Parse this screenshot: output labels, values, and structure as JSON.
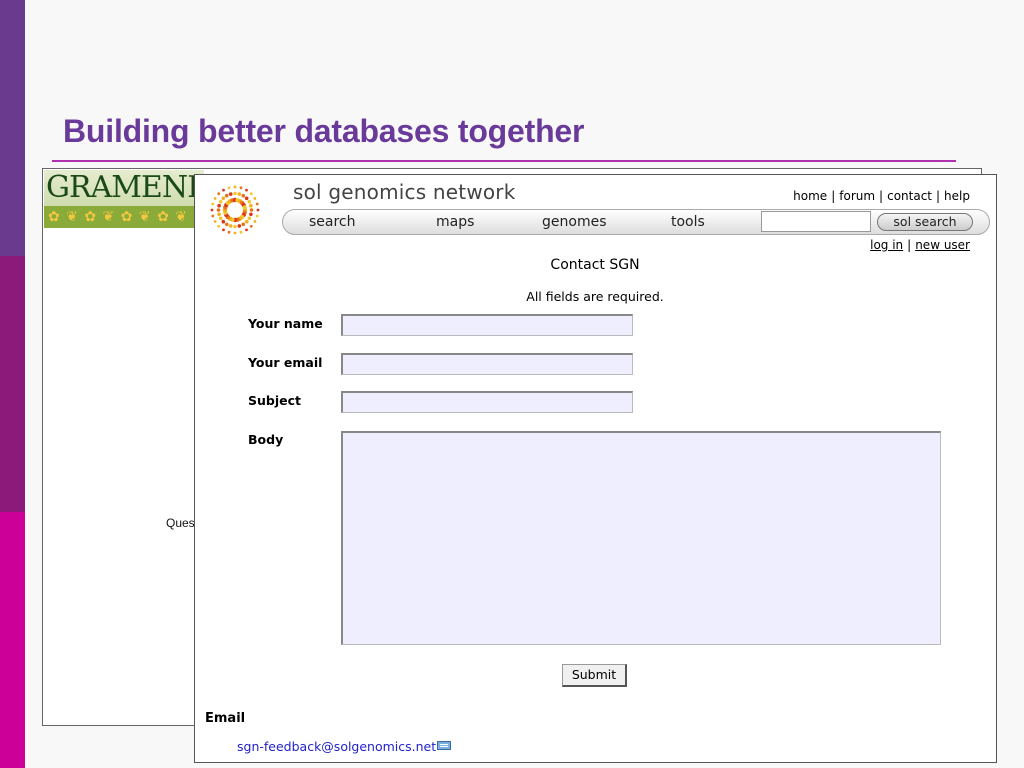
{
  "slide": {
    "title": "Building better databases together",
    "colors": {
      "bar_top": "#6a3a8e",
      "bar_mid": "#8b1a7a",
      "bar_bottom": "#cc0099",
      "title": "#6a3a9a"
    }
  },
  "gramene": {
    "logo_text": "GRAMENE",
    "partial_text": "Ques"
  },
  "sgn": {
    "site_name": "sol genomics network",
    "top_links": [
      "home",
      "forum",
      "contact",
      "help"
    ],
    "nav_items": [
      "search",
      "maps",
      "genomes",
      "tools"
    ],
    "search_placeholder": "",
    "search_button": "sol search",
    "login_links": [
      "log in",
      "new user"
    ],
    "page_title": "Contact SGN",
    "required_note": "All fields are required.",
    "fields": [
      {
        "label": "Your name",
        "value": ""
      },
      {
        "label": "Your email",
        "value": ""
      },
      {
        "label": "Subject",
        "value": ""
      }
    ],
    "body_label": "Body",
    "body_value": "",
    "submit_label": "Submit",
    "email_heading": "Email",
    "email_address": "sgn-feedback@solgenomics.net",
    "colors": {
      "input_bg": "#eeeeff",
      "link": "#2222cc"
    }
  }
}
